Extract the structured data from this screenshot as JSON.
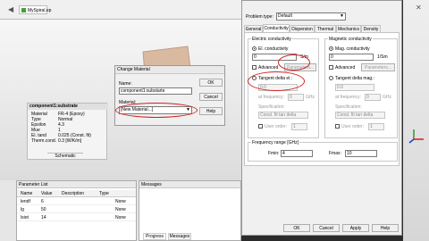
{
  "app": {
    "tab_title": "MySpiral.ep"
  },
  "component_panel": {
    "title": "component1:substrate",
    "rows": [
      {
        "key": "Material",
        "value": "FR-4 (Epoxy)"
      },
      {
        "key": "Type",
        "value": "Normal"
      },
      {
        "key": "Epsilon",
        "value": "4.3"
      },
      {
        "key": "Mue",
        "value": "1"
      },
      {
        "key": "El. tand",
        "value": "0.025 (Const. fit)"
      },
      {
        "key": "Therm.cond.",
        "value": "0.3 [W/K/m]"
      }
    ],
    "bottom_tab": "Schematic"
  },
  "parameter_list": {
    "title": "Parameter List",
    "columns": [
      "Name",
      "Value",
      "Description",
      "Type"
    ],
    "rows": [
      {
        "name": "lendf",
        "value": "6",
        "desc": "",
        "type": "None"
      },
      {
        "name": "lg",
        "value": "50",
        "desc": "",
        "type": "None"
      },
      {
        "name": "lsiot",
        "value": "14",
        "desc": "",
        "type": "None"
      }
    ]
  },
  "messages": {
    "title": "Messages",
    "tabs": [
      "Progress",
      "Messages"
    ]
  },
  "change_material": {
    "title": "Change Material",
    "name_label": "Name:",
    "name_value": "component1:substarte",
    "material_label": "Material:",
    "material_value": "[New Material...]",
    "ok": "OK",
    "cancel": "Cancel",
    "help": "Help"
  },
  "material_dialog": {
    "problem_type_label": "Problem type:",
    "problem_type_value": "Default",
    "tabs": [
      "General",
      "Conductivity",
      "Dispersion",
      "Thermal",
      "Mechanics",
      "Density"
    ],
    "electric": {
      "title": "Electric conductivity",
      "el_radio": "El. conductivity",
      "value": "0",
      "unit": "S/m",
      "advanced": "Advanced",
      "parameters": "Parameters...",
      "tangent": "Tangent delta el.:",
      "tan_value": "0.0",
      "at_frequency": "at frequency:",
      "freq_value": "0",
      "freq_unit": "GHz",
      "specification": "Specification:",
      "spec_value": "Const. fit tan delta",
      "user_order": "User order:",
      "order_value": "1"
    },
    "magnetic": {
      "title": "Magnetic conductivity",
      "mag_radio": "Mag. conductivity",
      "value": "0",
      "unit": "1/Sm",
      "advanced": "Advanced",
      "parameters": "Parameters...",
      "tangent": "Tangent delta mag.:",
      "tan_value": "0.0",
      "at_frequency": "at frequency:",
      "freq_value": "0",
      "freq_unit": "GHz",
      "specification": "Specification:",
      "spec_value": "Const. fit tan delta",
      "user_order": "User order:",
      "order_value": "1"
    },
    "frequency": {
      "title": "Frequency range [GHz]",
      "fmin_label": "Fmin:",
      "fmin_value": "4",
      "fmax_label": "Fmax:",
      "fmax_value": "10"
    },
    "buttons": {
      "ok": "OK",
      "cancel": "Cancel",
      "apply": "Apply",
      "help": "Help"
    }
  }
}
